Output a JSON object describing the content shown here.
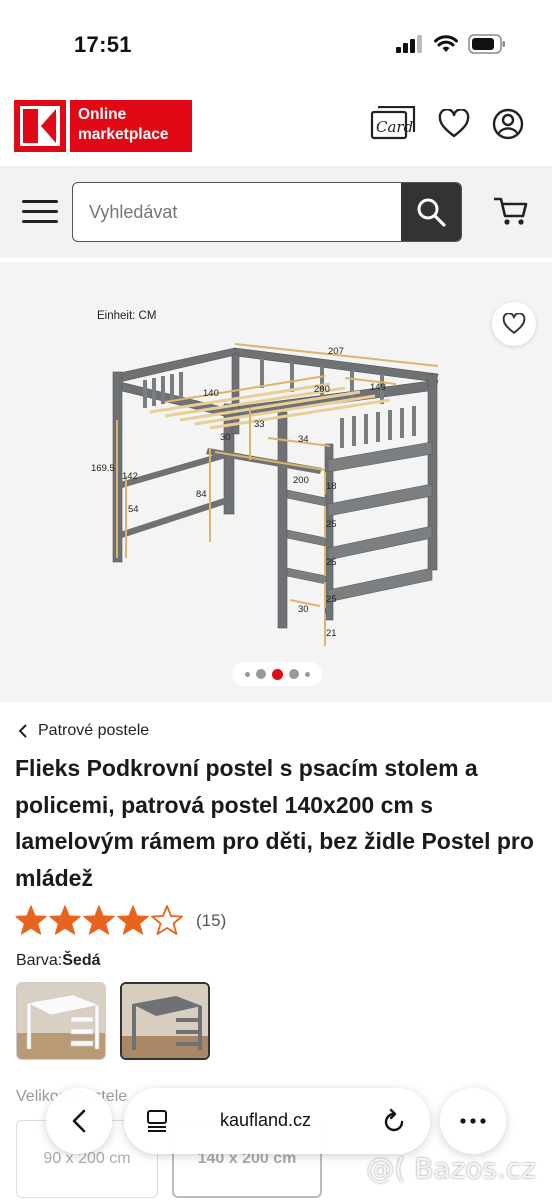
{
  "status_bar": {
    "time": "17:51"
  },
  "header": {
    "logo_text": "Online marketplace",
    "card_label": "Card"
  },
  "search": {
    "placeholder": "Vyhledávat"
  },
  "gallery": {
    "diagram": {
      "unit_label": "Einheit: CM",
      "dimensions": [
        "207",
        "200",
        "149",
        "140",
        "33",
        "30",
        "34",
        "169.5",
        "142",
        "54",
        "84",
        "200",
        "18",
        "25",
        "25",
        "25",
        "30",
        "21"
      ]
    },
    "slide_count": 5,
    "active_slide": 3
  },
  "product": {
    "breadcrumb": "Patrové postele",
    "title": "Flieks Podkrovní postel s psacím stolem a policemi, patrová postel 140x200 cm s lamelovým rámem pro děti, bez židle Postel pro mládež",
    "rating": {
      "stars": 4,
      "max": 5,
      "count": "(15)"
    },
    "color_label": "Barva:",
    "color_value": "Šedá",
    "size_label": "Velikost postele",
    "size_options": [
      "90 x 200 cm",
      "140 x 200 cm"
    ]
  },
  "browser": {
    "url": "kaufland.cz"
  },
  "watermark": "@( Bazos.cz",
  "colors": {
    "brand_red": "#e10915",
    "star_orange": "#e8641c",
    "frame_grey": "#6f7275"
  }
}
